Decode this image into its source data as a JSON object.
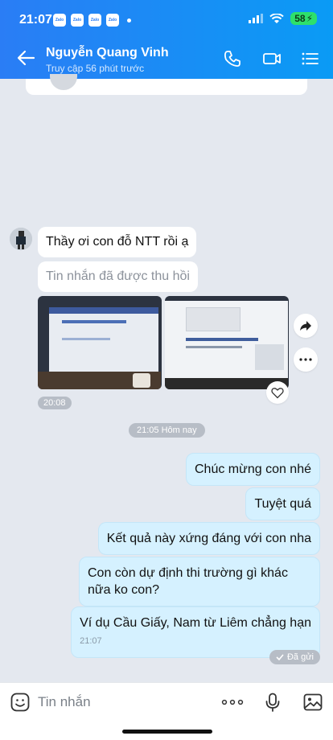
{
  "status_bar": {
    "time": "21:07",
    "notif_label": "Zalo",
    "battery": "58"
  },
  "header": {
    "contact_name": "Nguyễn Quang Vinh",
    "contact_status": "Truy cập 56 phút trước"
  },
  "messages": {
    "incoming_1": "Thầy ơi con đỗ NTT rồi ạ",
    "incoming_recalled": "Tin nhắn đã được thu hồi",
    "photos_time": "20:08",
    "day_separator": "21:05 Hôm nay",
    "outgoing": [
      "Chúc mừng con nhé",
      "Tuyệt quá",
      "Kết quả này xứng đáng với con nha",
      "Con còn dự định thi trường gì khác nữa ko con?",
      "Ví dụ Cầu Giấy, Nam từ Liêm chẳng hạn"
    ],
    "last_time": "21:07",
    "sent_status": "Đã gửi"
  },
  "input": {
    "placeholder": "Tin nhắn"
  },
  "colors": {
    "header_start": "#2a7df5",
    "header_end": "#0a9bf5",
    "outgoing_bubble": "#d5f1ff",
    "chat_background": "#e4e8ef"
  },
  "icons": [
    "back-arrow-icon",
    "phone-icon",
    "video-call-icon",
    "menu-list-icon",
    "share-icon",
    "more-icon",
    "heart-icon",
    "check-icon",
    "emoji-icon",
    "more-dots-icon",
    "microphone-icon",
    "image-icon"
  ]
}
